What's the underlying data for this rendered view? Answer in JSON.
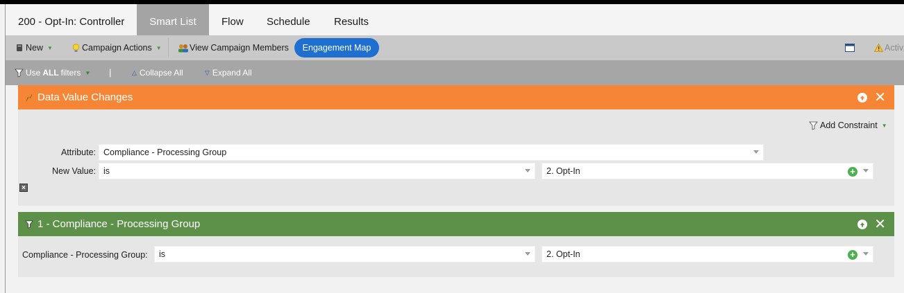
{
  "tabs": [
    {
      "label": "200 - Opt-In: Controller"
    },
    {
      "label": "Smart List"
    },
    {
      "label": "Flow"
    },
    {
      "label": "Schedule"
    },
    {
      "label": "Results"
    }
  ],
  "active_tab": "Smart List",
  "toolbar": {
    "new_label": "New",
    "campaign_actions_label": "Campaign Actions",
    "view_members_label": "View Campaign Members",
    "engagement_map_label": "Engagement Map",
    "status_label": "Activ"
  },
  "filterbar": {
    "use_label": "Use",
    "all_label": "ALL",
    "filters_label": "filters",
    "separator": "|",
    "collapse_label": "Collapse All",
    "expand_label": "Expand All"
  },
  "panel1": {
    "title": "Data Value Changes",
    "add_constraint_label": "Add Constraint",
    "attribute_label": "Attribute:",
    "attribute_value": "Compliance - Processing Group",
    "new_value_label": "New Value:",
    "operator_value": "is",
    "value": "2. Opt-In"
  },
  "panel2": {
    "title": "1 - Compliance - Processing Group",
    "field_label": "Compliance - Processing Group:",
    "operator_value": "is",
    "value": "2. Opt-In"
  },
  "colors": {
    "orange_header": "#f68636",
    "green_header": "#5d9049",
    "engagement_button": "#1e6fd0",
    "active_tab": "#a4a4a4"
  }
}
